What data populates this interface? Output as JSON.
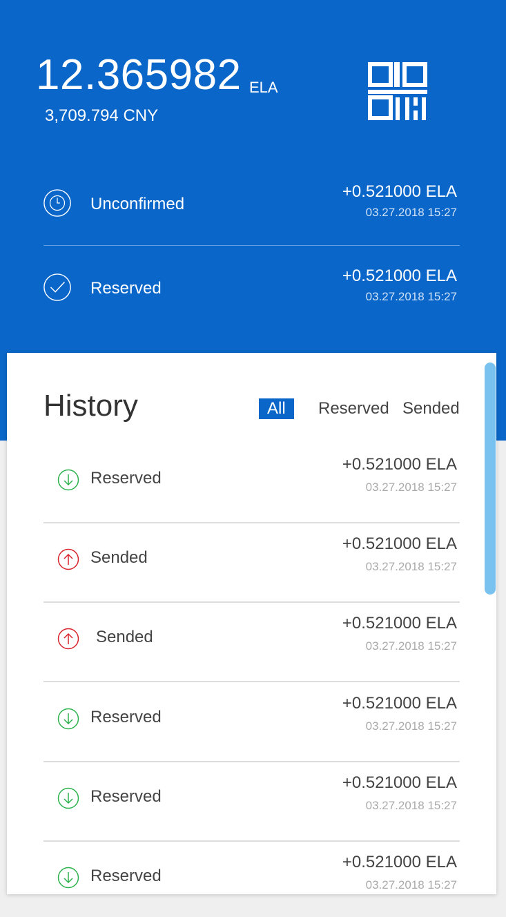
{
  "wallet": {
    "balance": "12.365982",
    "unit": "ELA",
    "fiat": "3,709.794 CNY"
  },
  "pending": [
    {
      "label": "Unconfirmed",
      "amount": "+0.521000 ELA",
      "time": "03.27.2018  15:27",
      "icon": "clock-icon"
    },
    {
      "label": "Reserved",
      "amount": "+0.521000 ELA",
      "time": "03.27.2018  15:27",
      "icon": "check-icon"
    }
  ],
  "history": {
    "title": "History",
    "filters": [
      "All",
      "Reserved",
      "Sended"
    ],
    "active_filter": "All",
    "rows": [
      {
        "label": "Reserved",
        "amount": "+0.521000 ELA",
        "time": "03.27.2018  15:27",
        "direction": "in"
      },
      {
        "label": "Sended",
        "amount": "+0.521000 ELA",
        "time": "03.27.2018  15:27",
        "direction": "out"
      },
      {
        "label": "Sended",
        "amount": "+0.521000 ELA",
        "time": "03.27.2018  15:27",
        "direction": "out"
      },
      {
        "label": "Reserved",
        "amount": "+0.521000 ELA",
        "time": "03.27.2018  15:27",
        "direction": "in"
      },
      {
        "label": "Reserved",
        "amount": "+0.521000 ELA",
        "time": "03.27.2018  15:27",
        "direction": "in"
      },
      {
        "label": "Reserved",
        "amount": "+0.521000 ELA",
        "time": "03.27.2018  15:27",
        "direction": "in"
      }
    ]
  },
  "colors": {
    "brand": "#0a66c8",
    "incoming": "#2bb24c",
    "outgoing": "#d8232a",
    "scrollbar": "#79c1ef"
  }
}
